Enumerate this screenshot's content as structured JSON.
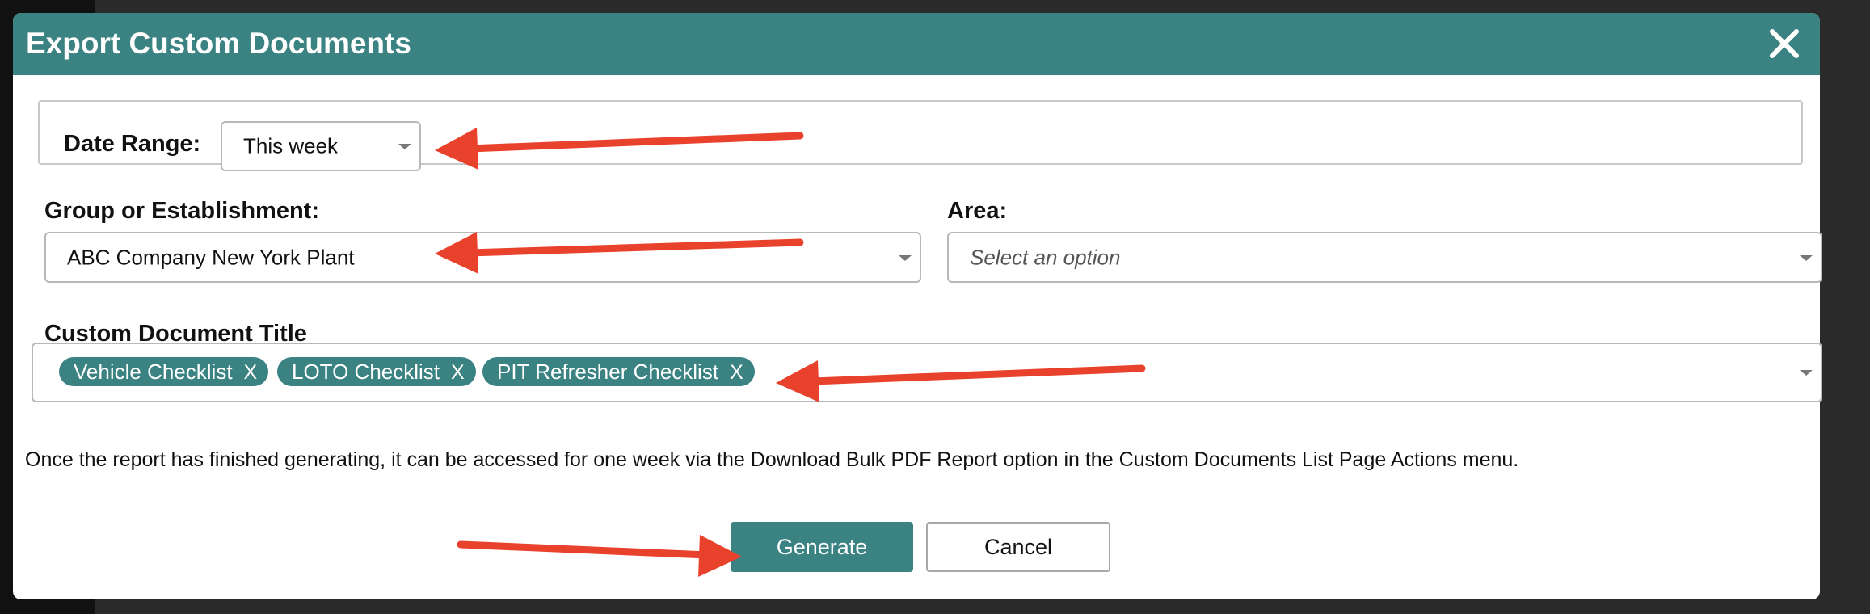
{
  "modal": {
    "title": "Export Custom Documents"
  },
  "date_range": {
    "label": "Date Range:",
    "value": "This week"
  },
  "group": {
    "label": "Group or Establishment:",
    "value": "ABC Company New York Plant"
  },
  "area": {
    "label": "Area:",
    "placeholder": "Select an option"
  },
  "custom_document_title": {
    "label": "Custom Document Title",
    "tags": [
      {
        "label": "Vehicle Checklist",
        "remove": "X"
      },
      {
        "label": "LOTO Checklist",
        "remove": "X"
      },
      {
        "label": "PIT Refresher Checklist",
        "remove": "X"
      }
    ]
  },
  "info_text": "Once the report has finished generating, it can be accessed for one week via the Download Bulk PDF Report option in the Custom Documents List Page Actions menu.",
  "buttons": {
    "generate": "Generate",
    "cancel": "Cancel"
  },
  "colors": {
    "header": "#3b8282",
    "primary_button": "#3b8282",
    "tag": "#3b8282",
    "annotation_arrow": "#e8412c"
  },
  "icons": {
    "close": "close-icon",
    "dropdown": "chevron-down-icon",
    "annotation": "arrow-icon"
  }
}
